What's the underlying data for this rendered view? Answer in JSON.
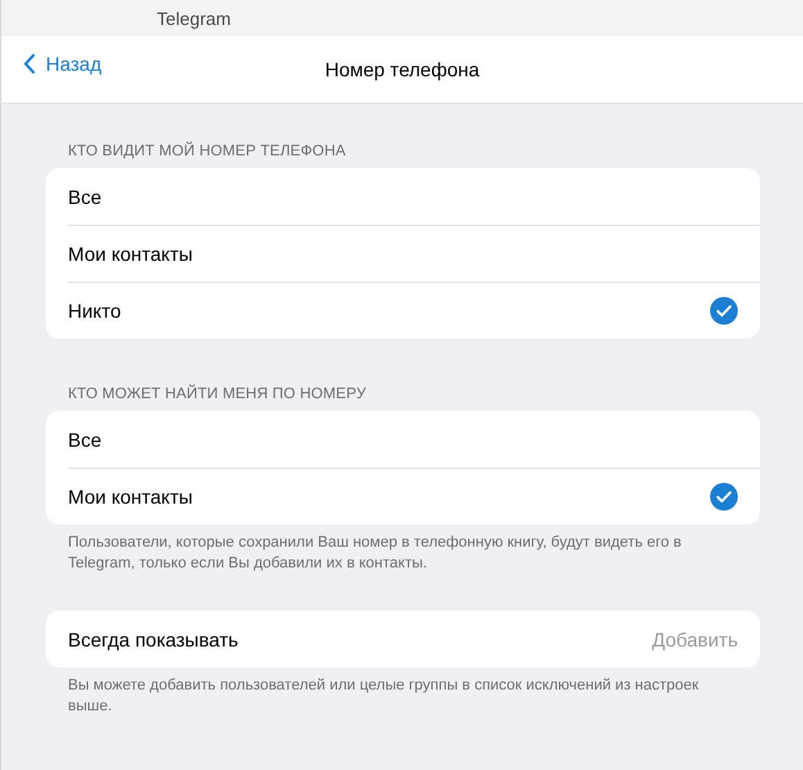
{
  "window": {
    "title": "Telegram"
  },
  "nav": {
    "back": "Назад",
    "title": "Номер телефона"
  },
  "sections": [
    {
      "header": "КТО ВИДИТ МОЙ НОМЕР ТЕЛЕФОНА",
      "options": [
        {
          "label": "Все",
          "selected": false
        },
        {
          "label": "Мои контакты",
          "selected": false
        },
        {
          "label": "Никто",
          "selected": true
        }
      ]
    },
    {
      "header": "КТО МОЖЕТ НАЙТИ МЕНЯ ПО НОМЕРУ",
      "options": [
        {
          "label": "Все",
          "selected": false
        },
        {
          "label": "Мои контакты",
          "selected": true
        }
      ],
      "footer": "Пользователи, которые сохранили Ваш номер в телефонную книгу, будут видеть его в Telegram, только если Вы добавили их в контакты."
    }
  ],
  "exceptions": {
    "label": "Всегда показывать",
    "action": "Добавить",
    "footer": "Вы можете добавить пользователей или целые группы в список исключений из настроек выше."
  }
}
